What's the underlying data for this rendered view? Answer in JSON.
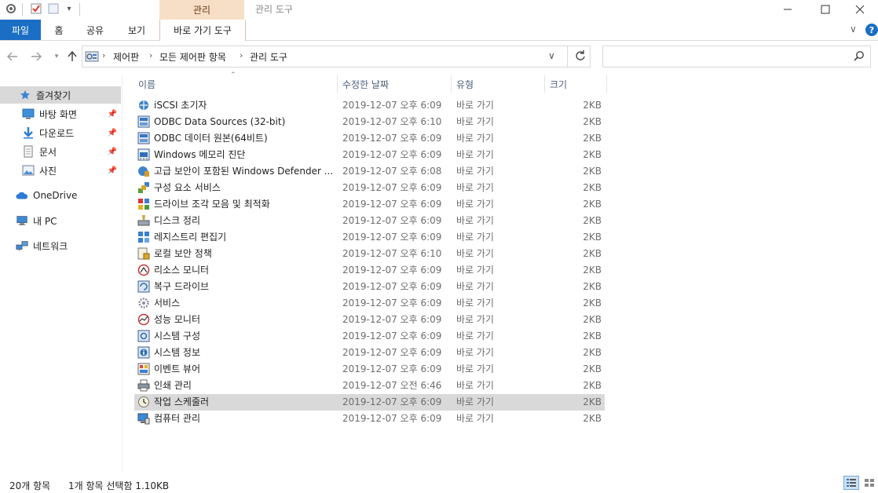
{
  "window": {
    "title": "관리 도구",
    "context_tab_header": "관리"
  },
  "ribbon": {
    "tabs": [
      "파일",
      "홈",
      "공유",
      "보기",
      "바로 가기 도구"
    ]
  },
  "address": {
    "crumbs": [
      "제어판",
      "모든 제어판 항목",
      "관리 도구"
    ],
    "search_placeholder": ""
  },
  "sidebar": {
    "items": [
      {
        "label": "즐겨찾기",
        "icon": "star-icon"
      },
      {
        "label": "바탕 화면",
        "icon": "desktop-icon",
        "pinned": true
      },
      {
        "label": "다운로드",
        "icon": "download-icon",
        "pinned": true
      },
      {
        "label": "문서",
        "icon": "document-icon",
        "pinned": true
      },
      {
        "label": "사진",
        "icon": "picture-icon",
        "pinned": true
      },
      {
        "label": "OneDrive",
        "icon": "cloud-icon"
      },
      {
        "label": "내 PC",
        "icon": "computer-icon"
      },
      {
        "label": "네트워크",
        "icon": "network-icon"
      }
    ]
  },
  "columns": {
    "name": "이름",
    "date": "수정한 날짜",
    "type": "유형",
    "size": "크기"
  },
  "files": [
    {
      "name": "iSCSI 초기자",
      "date": "2019-12-07 오후 6:09",
      "type": "바로 가기",
      "size": "2KB"
    },
    {
      "name": "ODBC Data Sources (32-bit)",
      "date": "2019-12-07 오후 6:10",
      "type": "바로 가기",
      "size": "2KB"
    },
    {
      "name": "ODBC 데이터 원본(64비트)",
      "date": "2019-12-07 오후 6:09",
      "type": "바로 가기",
      "size": "2KB"
    },
    {
      "name": "Windows 메모리 진단",
      "date": "2019-12-07 오후 6:09",
      "type": "바로 가기",
      "size": "2KB"
    },
    {
      "name": "고급 보안이 포함된 Windows Defender ...",
      "date": "2019-12-07 오후 6:08",
      "type": "바로 가기",
      "size": "2KB"
    },
    {
      "name": "구성 요소 서비스",
      "date": "2019-12-07 오후 6:09",
      "type": "바로 가기",
      "size": "2KB"
    },
    {
      "name": "드라이브 조각 모음 및 최적화",
      "date": "2019-12-07 오후 6:09",
      "type": "바로 가기",
      "size": "2KB"
    },
    {
      "name": "디스크 정리",
      "date": "2019-12-07 오후 6:09",
      "type": "바로 가기",
      "size": "2KB"
    },
    {
      "name": "레지스트리 편집기",
      "date": "2019-12-07 오후 6:09",
      "type": "바로 가기",
      "size": "2KB"
    },
    {
      "name": "로컬 보안 정책",
      "date": "2019-12-07 오후 6:10",
      "type": "바로 가기",
      "size": "2KB"
    },
    {
      "name": "리소스 모니터",
      "date": "2019-12-07 오후 6:09",
      "type": "바로 가기",
      "size": "2KB"
    },
    {
      "name": "복구 드라이브",
      "date": "2019-12-07 오후 6:09",
      "type": "바로 가기",
      "size": "2KB"
    },
    {
      "name": "서비스",
      "date": "2019-12-07 오후 6:09",
      "type": "바로 가기",
      "size": "2KB"
    },
    {
      "name": "성능 모니터",
      "date": "2019-12-07 오후 6:09",
      "type": "바로 가기",
      "size": "2KB"
    },
    {
      "name": "시스템 구성",
      "date": "2019-12-07 오후 6:09",
      "type": "바로 가기",
      "size": "2KB"
    },
    {
      "name": "시스템 정보",
      "date": "2019-12-07 오후 6:09",
      "type": "바로 가기",
      "size": "2KB"
    },
    {
      "name": "이벤트 뷰어",
      "date": "2019-12-07 오후 6:09",
      "type": "바로 가기",
      "size": "2KB"
    },
    {
      "name": "인쇄 관리",
      "date": "2019-12-07 오전 6:46",
      "type": "바로 가기",
      "size": "2KB"
    },
    {
      "name": "작업 스케줄러",
      "date": "2019-12-07 오후 6:09",
      "type": "바로 가기",
      "size": "2KB",
      "selected": true
    },
    {
      "name": "컴퓨터 관리",
      "date": "2019-12-07 오후 6:09",
      "type": "바로 가기",
      "size": "2KB"
    }
  ],
  "status": {
    "count": "20개 항목",
    "selection": "1개 항목 선택함 1.10KB"
  },
  "colors": {
    "file_tab": "#1a6fc4",
    "context_tab": "#f7dfc7",
    "selected_row": "#d9d9d9",
    "sidebar_selected": "#d9d9d9"
  }
}
